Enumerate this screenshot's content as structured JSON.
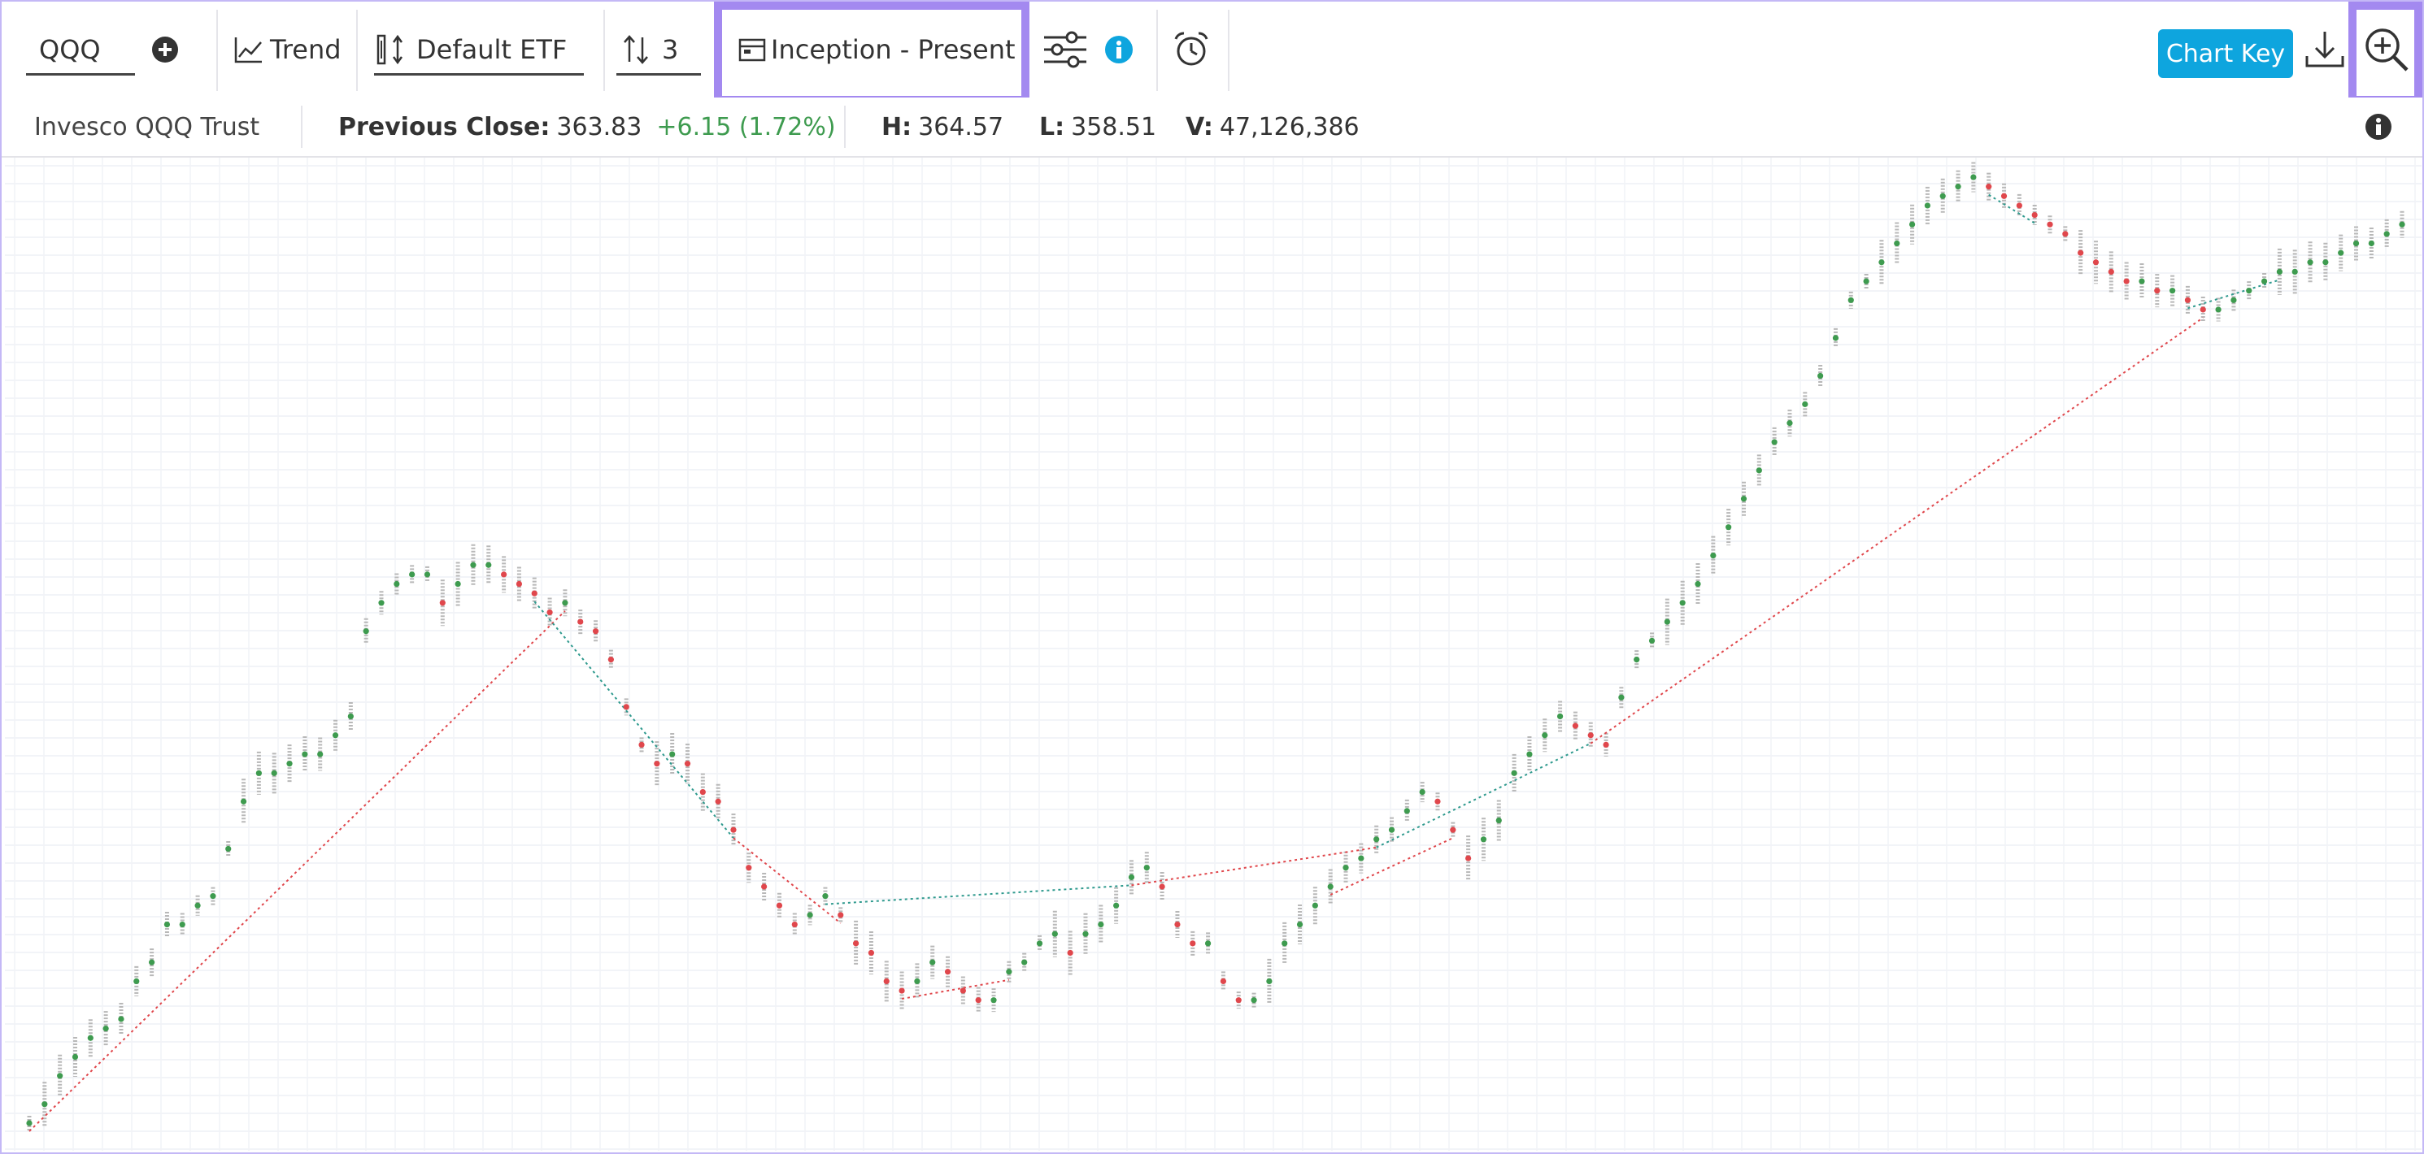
{
  "toolbar": {
    "symbol": "QQQ",
    "add_icon": "plus-circle-icon",
    "trend_label": "Trend",
    "default_etf_label": "Default ETF",
    "box_size_value": "3",
    "date_range_label": "Inception - Present",
    "chart_key_label": "Chart Key",
    "highlight_color": "#a389f0",
    "accent_color": "#0ea5de"
  },
  "infobar": {
    "name": "Invesco QQQ Trust",
    "prev_close_label": "Previous Close:",
    "prev_close_value": "363.83",
    "change": "+6.15 (1.72%)",
    "high_label": "H:",
    "high_value": "364.57",
    "low_label": "L:",
    "low_value": "358.51",
    "volume_label": "V:",
    "volume_value": "47,126,386",
    "up_color": "#3e9b4f"
  },
  "chart_data": {
    "type": "scatter",
    "x": [
      0,
      10,
      20,
      30,
      40,
      50,
      60,
      70,
      80,
      90,
      100,
      110,
      120,
      130,
      140,
      150,
      160,
      170,
      180,
      190,
      200,
      210,
      220,
      230,
      240,
      250,
      260,
      270,
      280,
      290,
      300,
      310,
      320,
      330,
      340,
      350,
      360,
      370,
      380,
      390,
      400,
      410,
      420,
      430,
      440,
      450,
      460,
      470,
      480,
      490,
      500,
      510,
      520,
      530,
      540,
      550,
      560,
      570,
      580,
      590,
      600,
      610,
      620,
      630,
      640,
      650,
      660,
      670,
      680,
      690,
      700,
      710,
      720,
      730,
      740,
      750,
      760,
      770,
      780,
      790,
      800,
      810,
      820,
      830,
      840,
      850,
      860,
      870,
      880,
      890,
      900,
      910,
      920,
      930,
      940,
      950,
      960,
      970,
      980,
      990,
      1000,
      1010,
      1020,
      1030,
      1040,
      1050,
      1060,
      1070,
      1080,
      1090,
      1100,
      1110,
      1120,
      1130,
      1140,
      1150,
      1160,
      1170,
      1180,
      1190,
      1200,
      1210,
      1220,
      1230,
      1240,
      1250,
      1260,
      1270,
      1280,
      1290,
      1300,
      1310,
      1320,
      1330,
      1340,
      1350,
      1360,
      1370,
      1380,
      1390,
      1400,
      1410,
      1420,
      1430,
      1440,
      1450,
      1460,
      1470,
      1480,
      1490,
      1500,
      1510,
      1520,
      1530,
      1540,
      1550
    ],
    "y": [
      0.0,
      0.02,
      0.05,
      0.07,
      0.09,
      0.1,
      0.11,
      0.15,
      0.17,
      0.21,
      0.21,
      0.23,
      0.24,
      0.29,
      0.34,
      0.37,
      0.37,
      0.38,
      0.39,
      0.39,
      0.41,
      0.43,
      0.52,
      0.55,
      0.57,
      0.58,
      0.58,
      0.55,
      0.57,
      0.59,
      0.59,
      0.58,
      0.57,
      0.56,
      0.54,
      0.55,
      0.53,
      0.52,
      0.49,
      0.44,
      0.4,
      0.38,
      0.39,
      0.38,
      0.35,
      0.34,
      0.31,
      0.27,
      0.25,
      0.23,
      0.21,
      0.22,
      0.24,
      0.22,
      0.19,
      0.18,
      0.15,
      0.14,
      0.15,
      0.17,
      0.16,
      0.14,
      0.13,
      0.13,
      0.16,
      0.17,
      0.19,
      0.2,
      0.18,
      0.2,
      0.21,
      0.23,
      0.26,
      0.27,
      0.25,
      0.21,
      0.19,
      0.19,
      0.15,
      0.13,
      0.13,
      0.15,
      0.19,
      0.21,
      0.23,
      0.25,
      0.27,
      0.28,
      0.3,
      0.31,
      0.33,
      0.35,
      0.34,
      0.31,
      0.28,
      0.3,
      0.32,
      0.37,
      0.39,
      0.41,
      0.43,
      0.42,
      0.41,
      0.4,
      0.45,
      0.49,
      0.51,
      0.53,
      0.55,
      0.57,
      0.6,
      0.63,
      0.66,
      0.69,
      0.72,
      0.74,
      0.76,
      0.79,
      0.83,
      0.87,
      0.89,
      0.91,
      0.93,
      0.95,
      0.97,
      0.98,
      0.99,
      1.0,
      0.99,
      0.98,
      0.97,
      0.96,
      0.95,
      0.94,
      0.92,
      0.91,
      0.9,
      0.89,
      0.89,
      0.88,
      0.88,
      0.87,
      0.86,
      0.86,
      0.87,
      0.88,
      0.89,
      0.9,
      0.9,
      0.91,
      0.91,
      0.92,
      0.93,
      0.93,
      0.94,
      0.95
    ],
    "dot_up_color": "#3e9b4f",
    "dot_down_color": "#e0474c",
    "mark_color": "#b8b8b8",
    "support_color": "#e0474c",
    "resistance_color": "#2f9a8e"
  }
}
